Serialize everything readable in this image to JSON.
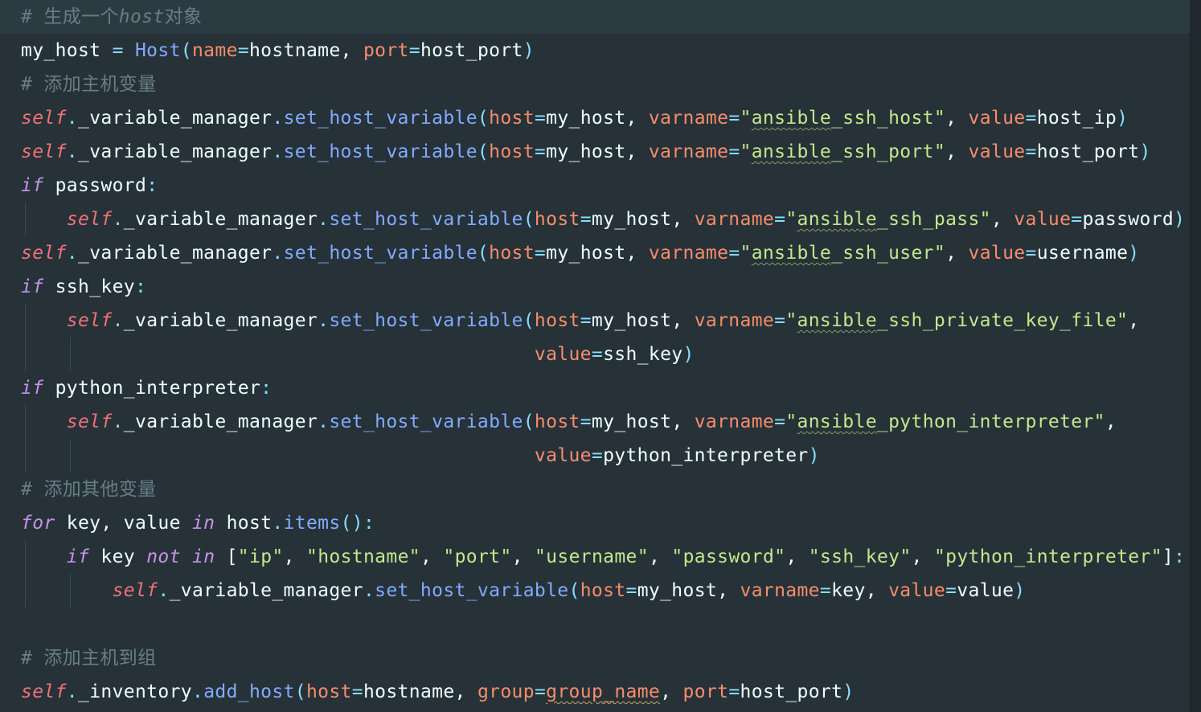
{
  "editor": {
    "theme_colors": {
      "background": "#263238",
      "keyword": "#c792ea",
      "self": "#f07178",
      "comment": "#697d87",
      "function": "#82aaff",
      "parameter": "#f78c6c",
      "operator": "#89ddff",
      "string": "#c3e88d",
      "identifier": "#eeffff"
    },
    "lines": [
      [
        {
          "t": "# 生成一个",
          "c": "cm"
        },
        {
          "t": "host",
          "c": "cm-i"
        },
        {
          "t": "对象",
          "c": "cm"
        }
      ],
      [
        {
          "t": "my_host",
          "c": "id"
        },
        {
          "t": " = ",
          "c": "op"
        },
        {
          "t": "Host",
          "c": "cls"
        },
        {
          "t": "(",
          "c": "punc"
        },
        {
          "t": "name",
          "c": "param"
        },
        {
          "t": "=",
          "c": "op"
        },
        {
          "t": "hostname",
          "c": "id"
        },
        {
          "t": ", ",
          "c": "id"
        },
        {
          "t": "port",
          "c": "param"
        },
        {
          "t": "=",
          "c": "op"
        },
        {
          "t": "host_port",
          "c": "id"
        },
        {
          "t": ")",
          "c": "punc"
        }
      ],
      [
        {
          "t": "# 添加主机变量",
          "c": "cm"
        }
      ],
      [
        {
          "t": "self",
          "c": "self"
        },
        {
          "t": ".",
          "c": "punc"
        },
        {
          "t": "_variable_manager",
          "c": "id"
        },
        {
          "t": ".",
          "c": "punc"
        },
        {
          "t": "set_host_variable",
          "c": "fn"
        },
        {
          "t": "(",
          "c": "punc"
        },
        {
          "t": "host",
          "c": "param"
        },
        {
          "t": "=",
          "c": "op"
        },
        {
          "t": "my_host",
          "c": "id"
        },
        {
          "t": ", ",
          "c": "id"
        },
        {
          "t": "varname",
          "c": "param"
        },
        {
          "t": "=",
          "c": "op"
        },
        {
          "t": "\"",
          "c": "str"
        },
        {
          "t": "ansible",
          "c": "str",
          "u": 1
        },
        {
          "t": "_ssh_host\"",
          "c": "str"
        },
        {
          "t": ", ",
          "c": "id"
        },
        {
          "t": "value",
          "c": "param"
        },
        {
          "t": "=",
          "c": "op"
        },
        {
          "t": "host_ip",
          "c": "id"
        },
        {
          "t": ")",
          "c": "punc"
        }
      ],
      [
        {
          "t": "self",
          "c": "self"
        },
        {
          "t": ".",
          "c": "punc"
        },
        {
          "t": "_variable_manager",
          "c": "id"
        },
        {
          "t": ".",
          "c": "punc"
        },
        {
          "t": "set_host_variable",
          "c": "fn"
        },
        {
          "t": "(",
          "c": "punc"
        },
        {
          "t": "host",
          "c": "param"
        },
        {
          "t": "=",
          "c": "op"
        },
        {
          "t": "my_host",
          "c": "id"
        },
        {
          "t": ", ",
          "c": "id"
        },
        {
          "t": "varname",
          "c": "param"
        },
        {
          "t": "=",
          "c": "op"
        },
        {
          "t": "\"",
          "c": "str"
        },
        {
          "t": "ansible",
          "c": "str",
          "u": 1
        },
        {
          "t": "_ssh_port\"",
          "c": "str"
        },
        {
          "t": ", ",
          "c": "id"
        },
        {
          "t": "value",
          "c": "param"
        },
        {
          "t": "=",
          "c": "op"
        },
        {
          "t": "host_port",
          "c": "id"
        },
        {
          "t": ")",
          "c": "punc"
        }
      ],
      [
        {
          "t": "if",
          "c": "kw"
        },
        {
          "t": " password",
          "c": "id"
        },
        {
          "t": ":",
          "c": "punc"
        }
      ],
      [
        {
          "t": "    ",
          "c": "id"
        },
        {
          "t": "self",
          "c": "self"
        },
        {
          "t": ".",
          "c": "punc"
        },
        {
          "t": "_variable_manager",
          "c": "id"
        },
        {
          "t": ".",
          "c": "punc"
        },
        {
          "t": "set_host_variable",
          "c": "fn"
        },
        {
          "t": "(",
          "c": "punc"
        },
        {
          "t": "host",
          "c": "param"
        },
        {
          "t": "=",
          "c": "op"
        },
        {
          "t": "my_host",
          "c": "id"
        },
        {
          "t": ", ",
          "c": "id"
        },
        {
          "t": "varname",
          "c": "param"
        },
        {
          "t": "=",
          "c": "op"
        },
        {
          "t": "\"",
          "c": "str"
        },
        {
          "t": "ansible",
          "c": "str",
          "u": 1
        },
        {
          "t": "_ssh_pass\"",
          "c": "str"
        },
        {
          "t": ", ",
          "c": "id"
        },
        {
          "t": "value",
          "c": "param"
        },
        {
          "t": "=",
          "c": "op"
        },
        {
          "t": "password",
          "c": "id"
        },
        {
          "t": ")",
          "c": "punc"
        }
      ],
      [
        {
          "t": "self",
          "c": "self"
        },
        {
          "t": ".",
          "c": "punc"
        },
        {
          "t": "_variable_manager",
          "c": "id"
        },
        {
          "t": ".",
          "c": "punc"
        },
        {
          "t": "set_host_variable",
          "c": "fn"
        },
        {
          "t": "(",
          "c": "punc"
        },
        {
          "t": "host",
          "c": "param"
        },
        {
          "t": "=",
          "c": "op"
        },
        {
          "t": "my_host",
          "c": "id"
        },
        {
          "t": ", ",
          "c": "id"
        },
        {
          "t": "varname",
          "c": "param"
        },
        {
          "t": "=",
          "c": "op"
        },
        {
          "t": "\"",
          "c": "str"
        },
        {
          "t": "ansible",
          "c": "str",
          "u": 1
        },
        {
          "t": "_ssh_user\"",
          "c": "str"
        },
        {
          "t": ", ",
          "c": "id"
        },
        {
          "t": "value",
          "c": "param"
        },
        {
          "t": "=",
          "c": "op"
        },
        {
          "t": "username",
          "c": "id"
        },
        {
          "t": ")",
          "c": "punc"
        }
      ],
      [
        {
          "t": "if",
          "c": "kw"
        },
        {
          "t": " ssh_key",
          "c": "id"
        },
        {
          "t": ":",
          "c": "punc"
        }
      ],
      [
        {
          "t": "    ",
          "c": "id"
        },
        {
          "t": "self",
          "c": "self"
        },
        {
          "t": ".",
          "c": "punc"
        },
        {
          "t": "_variable_manager",
          "c": "id"
        },
        {
          "t": ".",
          "c": "punc"
        },
        {
          "t": "set_host_variable",
          "c": "fn"
        },
        {
          "t": "(",
          "c": "punc"
        },
        {
          "t": "host",
          "c": "param"
        },
        {
          "t": "=",
          "c": "op"
        },
        {
          "t": "my_host",
          "c": "id"
        },
        {
          "t": ", ",
          "c": "id"
        },
        {
          "t": "varname",
          "c": "param"
        },
        {
          "t": "=",
          "c": "op"
        },
        {
          "t": "\"",
          "c": "str"
        },
        {
          "t": "ansible",
          "c": "str",
          "u": 1
        },
        {
          "t": "_ssh_private_key_file\"",
          "c": "str"
        },
        {
          "t": ",",
          "c": "id"
        }
      ],
      [
        {
          "t": "                                             ",
          "c": "id"
        },
        {
          "t": "value",
          "c": "param"
        },
        {
          "t": "=",
          "c": "op"
        },
        {
          "t": "ssh_key",
          "c": "id"
        },
        {
          "t": ")",
          "c": "punc"
        }
      ],
      [
        {
          "t": "if",
          "c": "kw"
        },
        {
          "t": " python_interpreter",
          "c": "id"
        },
        {
          "t": ":",
          "c": "punc"
        }
      ],
      [
        {
          "t": "    ",
          "c": "id"
        },
        {
          "t": "self",
          "c": "self"
        },
        {
          "t": ".",
          "c": "punc"
        },
        {
          "t": "_variable_manager",
          "c": "id"
        },
        {
          "t": ".",
          "c": "punc"
        },
        {
          "t": "set_host_variable",
          "c": "fn"
        },
        {
          "t": "(",
          "c": "punc"
        },
        {
          "t": "host",
          "c": "param"
        },
        {
          "t": "=",
          "c": "op"
        },
        {
          "t": "my_host",
          "c": "id"
        },
        {
          "t": ", ",
          "c": "id"
        },
        {
          "t": "varname",
          "c": "param"
        },
        {
          "t": "=",
          "c": "op"
        },
        {
          "t": "\"",
          "c": "str"
        },
        {
          "t": "ansible",
          "c": "str",
          "u": 1
        },
        {
          "t": "_python_interpreter\"",
          "c": "str"
        },
        {
          "t": ",",
          "c": "id"
        }
      ],
      [
        {
          "t": "                                             ",
          "c": "id"
        },
        {
          "t": "value",
          "c": "param"
        },
        {
          "t": "=",
          "c": "op"
        },
        {
          "t": "python_interpreter",
          "c": "id"
        },
        {
          "t": ")",
          "c": "punc"
        }
      ],
      [
        {
          "t": "# 添加其他变量",
          "c": "cm"
        }
      ],
      [
        {
          "t": "for",
          "c": "kw"
        },
        {
          "t": " key, value ",
          "c": "id"
        },
        {
          "t": "in",
          "c": "kw"
        },
        {
          "t": " host",
          "c": "id"
        },
        {
          "t": ".",
          "c": "punc"
        },
        {
          "t": "items",
          "c": "fn"
        },
        {
          "t": "()",
          "c": "punc"
        },
        {
          "t": ":",
          "c": "punc"
        }
      ],
      [
        {
          "t": "    ",
          "c": "id"
        },
        {
          "t": "if",
          "c": "kw"
        },
        {
          "t": " key ",
          "c": "id"
        },
        {
          "t": "not in",
          "c": "kw"
        },
        {
          "t": " [",
          "c": "id"
        },
        {
          "t": "\"ip\"",
          "c": "str"
        },
        {
          "t": ", ",
          "c": "id"
        },
        {
          "t": "\"hostname\"",
          "c": "str"
        },
        {
          "t": ", ",
          "c": "id"
        },
        {
          "t": "\"port\"",
          "c": "str"
        },
        {
          "t": ", ",
          "c": "id"
        },
        {
          "t": "\"username\"",
          "c": "str"
        },
        {
          "t": ", ",
          "c": "id"
        },
        {
          "t": "\"password\"",
          "c": "str"
        },
        {
          "t": ", ",
          "c": "id"
        },
        {
          "t": "\"ssh_key\"",
          "c": "str"
        },
        {
          "t": ", ",
          "c": "id"
        },
        {
          "t": "\"python_interpreter\"",
          "c": "str"
        },
        {
          "t": "]",
          "c": "id"
        },
        {
          "t": ":",
          "c": "punc"
        }
      ],
      [
        {
          "t": "        ",
          "c": "id"
        },
        {
          "t": "self",
          "c": "self"
        },
        {
          "t": ".",
          "c": "punc"
        },
        {
          "t": "_variable_manager",
          "c": "id"
        },
        {
          "t": ".",
          "c": "punc"
        },
        {
          "t": "set_host_variable",
          "c": "fn"
        },
        {
          "t": "(",
          "c": "punc"
        },
        {
          "t": "host",
          "c": "param"
        },
        {
          "t": "=",
          "c": "op"
        },
        {
          "t": "my_host",
          "c": "id"
        },
        {
          "t": ", ",
          "c": "id"
        },
        {
          "t": "varname",
          "c": "param"
        },
        {
          "t": "=",
          "c": "op"
        },
        {
          "t": "key",
          "c": "id"
        },
        {
          "t": ", ",
          "c": "id"
        },
        {
          "t": "value",
          "c": "param"
        },
        {
          "t": "=",
          "c": "op"
        },
        {
          "t": "value",
          "c": "id"
        },
        {
          "t": ")",
          "c": "punc"
        }
      ],
      [],
      [
        {
          "t": "# 添加主机到组",
          "c": "cm"
        }
      ],
      [
        {
          "t": "self",
          "c": "self"
        },
        {
          "t": ".",
          "c": "punc"
        },
        {
          "t": "_inventory",
          "c": "id"
        },
        {
          "t": ".",
          "c": "punc"
        },
        {
          "t": "add_host",
          "c": "fn"
        },
        {
          "t": "(",
          "c": "punc"
        },
        {
          "t": "host",
          "c": "param"
        },
        {
          "t": "=",
          "c": "op"
        },
        {
          "t": "hostname",
          "c": "id"
        },
        {
          "t": ", ",
          "c": "id"
        },
        {
          "t": "group",
          "c": "param"
        },
        {
          "t": "=",
          "c": "op"
        },
        {
          "t": "group_name",
          "c": "param",
          "u": 2
        },
        {
          "t": ", ",
          "c": "id"
        },
        {
          "t": "port",
          "c": "param"
        },
        {
          "t": "=",
          "c": "op"
        },
        {
          "t": "host_port",
          "c": "id"
        },
        {
          "t": ")",
          "c": "punc"
        }
      ]
    ]
  }
}
